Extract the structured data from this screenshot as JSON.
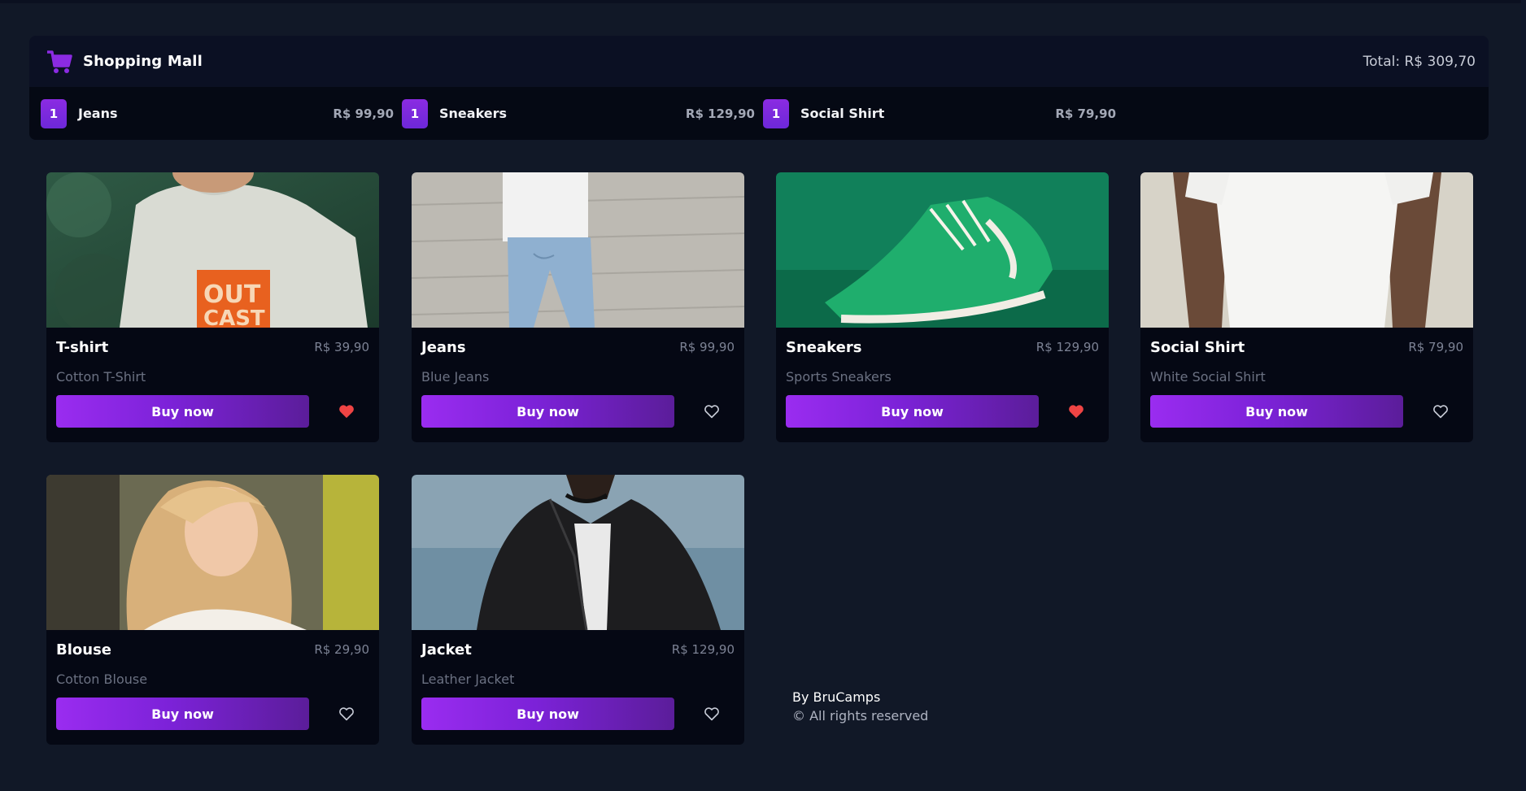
{
  "header": {
    "title": "Shopping Mall",
    "cart_icon": "shopping-cart-icon",
    "total": "Total: R$ 309,70"
  },
  "cart": [
    {
      "qty": "1",
      "name": "Jeans",
      "price": "R$ 99,90"
    },
    {
      "qty": "1",
      "name": "Sneakers",
      "price": "R$ 129,90"
    },
    {
      "qty": "1",
      "name": "Social Shirt",
      "price": "R$ 79,90"
    }
  ],
  "products": [
    {
      "name": "T-shirt",
      "price": "R$ 39,90",
      "description": "Cotton T-Shirt",
      "buy_label": "Buy now",
      "favorited": true,
      "image": "photo-t-shirt"
    },
    {
      "name": "Jeans",
      "price": "R$ 99,90",
      "description": "Blue Jeans",
      "buy_label": "Buy now",
      "favorited": false,
      "image": "photo-jeans"
    },
    {
      "name": "Sneakers",
      "price": "R$ 129,90",
      "description": "Sports Sneakers",
      "buy_label": "Buy now",
      "favorited": true,
      "image": "photo-sneakers"
    },
    {
      "name": "Social Shirt",
      "price": "R$ 79,90",
      "description": "White Social Shirt",
      "buy_label": "Buy now",
      "favorited": false,
      "image": "photo-social-shirt"
    },
    {
      "name": "Blouse",
      "price": "R$ 29,90",
      "description": "Cotton Blouse",
      "buy_label": "Buy now",
      "favorited": false,
      "image": "photo-blouse"
    },
    {
      "name": "Jacket",
      "price": "R$ 129,90",
      "description": "Leather Jacket",
      "buy_label": "Buy now",
      "favorited": false,
      "image": "photo-jacket"
    }
  ],
  "footer": {
    "by": "By BruCamps",
    "rights": "© All rights reserved"
  },
  "colors": {
    "background": "#111827",
    "accent": "#8b2be2",
    "favorite": "#ef4444"
  }
}
